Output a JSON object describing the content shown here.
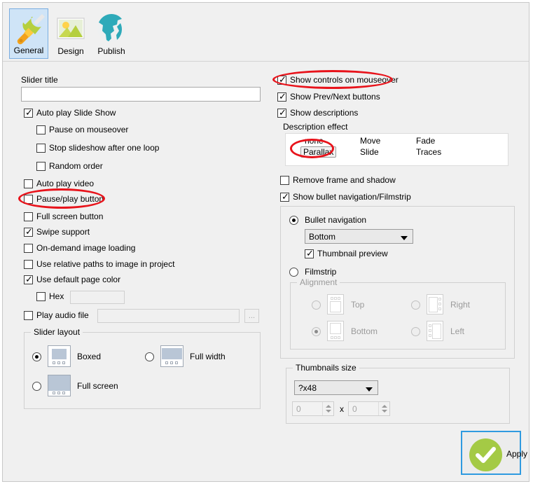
{
  "tabs": [
    {
      "label": "General",
      "icon": "tools-icon",
      "selected": true
    },
    {
      "label": "Design",
      "icon": "picture-icon",
      "selected": false
    },
    {
      "label": "Publish",
      "icon": "globe-icon",
      "selected": false
    }
  ],
  "left": {
    "slider_title_label": "Slider title",
    "slider_title_value": "",
    "auto_play_slide_show": "Auto play Slide Show",
    "pause_on_mouseover": "Pause on mouseover",
    "stop_after_one_loop": "Stop slideshow after one loop",
    "random_order": "Random order",
    "auto_play_video": "Auto play video",
    "pause_play_button": "Pause/play button",
    "full_screen_button": "Full screen button",
    "swipe_support": "Swipe support",
    "on_demand_loading": "On-demand image loading",
    "relative_paths": "Use relative paths to image in project",
    "default_page_color": "Use default page color",
    "hex_label": "Hex",
    "hex_value": "",
    "play_audio_file": "Play audio file",
    "audio_path_value": "",
    "browse_label": "...",
    "slider_layout_title": "Slider layout",
    "layout_boxed": "Boxed",
    "layout_full_width": "Full width",
    "layout_full_screen": "Full screen"
  },
  "right": {
    "show_controls_on_mouseover": "Show controls on mouseover",
    "show_prev_next": "Show Prev/Next buttons",
    "show_descriptions": "Show descriptions",
    "description_effect_label": "Description effect",
    "description_effects": [
      "none",
      "Parallax",
      "Move",
      "Slide",
      "Fade",
      "Traces"
    ],
    "description_effect_selected": "Parallax",
    "remove_frame_and_shadow": "Remove frame and shadow",
    "show_bullet_nav_filmstrip": "Show bullet navigation/Filmstrip",
    "bullet_navigation": "Bullet navigation",
    "bullet_position_value": "Bottom",
    "thumbnail_preview": "Thumbnail preview",
    "filmstrip": "Filmstrip",
    "alignment_title": "Alignment",
    "align_top": "Top",
    "align_right": "Right",
    "align_bottom": "Bottom",
    "align_left": "Left",
    "thumbnails_size_title": "Thumbnails size",
    "thumbnails_size_value": "?x48",
    "thumb_width_value": "0",
    "thumb_sep": "x",
    "thumb_height_value": "0"
  },
  "footer": {
    "apply_label": "Apply"
  },
  "colors": {
    "accent": "#2f9ae0",
    "apply_green": "#a4ca45",
    "highlight_red": "#e8131b",
    "tab_selected": "#cfe4f7",
    "panel_bg": "#f0f0f0"
  }
}
